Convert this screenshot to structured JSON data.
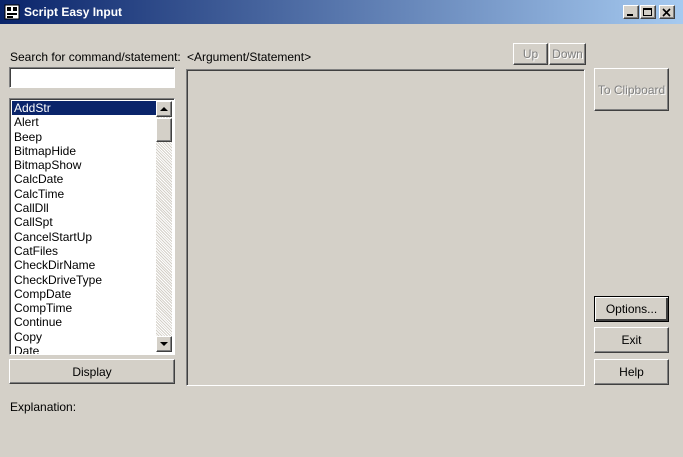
{
  "window": {
    "title": "Script Easy Input"
  },
  "search": {
    "label": "Search for command/statement:",
    "value": ""
  },
  "commands": {
    "items": [
      "AddStr",
      "Alert",
      "Beep",
      "BitmapHide",
      "BitmapShow",
      "CalcDate",
      "CalcTime",
      "CallDll",
      "CallSpt",
      "CancelStartUp",
      "CatFiles",
      "CheckDirName",
      "CheckDriveType",
      "CompDate",
      "CompTime",
      "Continue",
      "Copy",
      "Date"
    ],
    "selected_index": 0
  },
  "argument": {
    "label": "<Argument/Statement>"
  },
  "buttons": {
    "up": "Up",
    "down": "Down",
    "to_clipboard": "To Clipboard",
    "options": "Options...",
    "exit": "Exit",
    "help": "Help",
    "display": "Display"
  },
  "explanation": {
    "label": "Explanation:"
  },
  "icons": {
    "app": "script-app-icon",
    "minimize": "minimize-icon",
    "maximize": "maximize-icon",
    "close": "close-icon",
    "scroll_up": "arrow-up-icon",
    "scroll_down": "arrow-down-icon"
  },
  "colors": {
    "title_start": "#0a246a",
    "title_end": "#a6caf0",
    "face": "#d4d0c8",
    "selection": "#0a246a"
  }
}
